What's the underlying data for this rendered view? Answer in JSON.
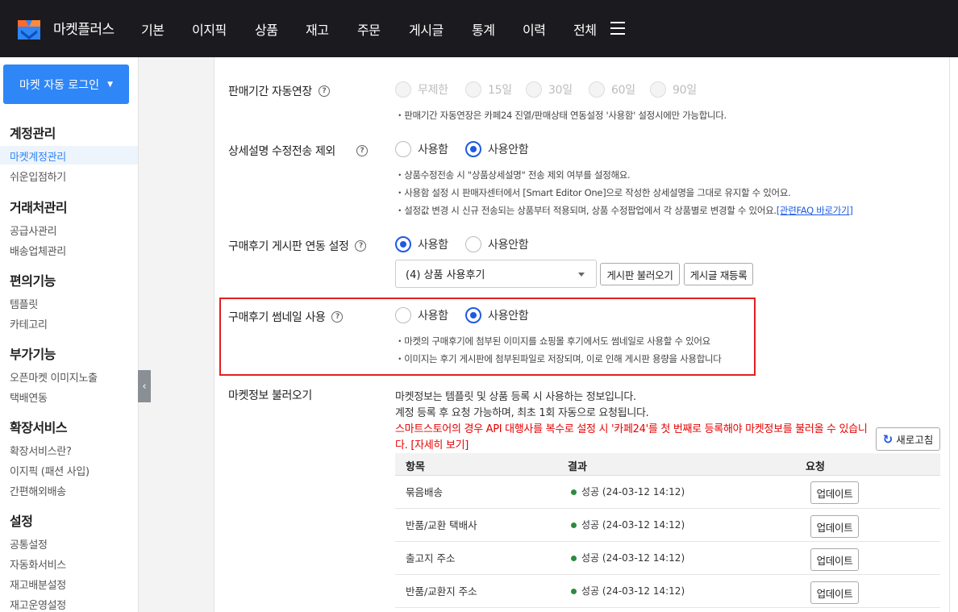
{
  "brand": "마켓플러스",
  "nav": [
    "기본",
    "이지픽",
    "상품",
    "재고",
    "주문",
    "게시글",
    "통계",
    "이력",
    "전체"
  ],
  "sidebar": {
    "login_button": "마켓 자동 로그인",
    "groups": [
      {
        "title": "계정관리",
        "items": [
          "마켓계정관리",
          "쉬운입점하기"
        ]
      },
      {
        "title": "거래처관리",
        "items": [
          "공급사관리",
          "배송업체관리"
        ]
      },
      {
        "title": "편의기능",
        "items": [
          "템플릿",
          "카테고리"
        ]
      },
      {
        "title": "부가기능",
        "items": [
          "오픈마켓 이미지노출",
          "택배연동"
        ]
      },
      {
        "title": "확장서비스",
        "items": [
          "확장서비스란?",
          "이지픽 (패션 사입)",
          "간편해외배송"
        ]
      },
      {
        "title": "설정",
        "items": [
          "공통설정",
          "자동화서비스",
          "재고배분설정",
          "재고운영설정"
        ]
      }
    ]
  },
  "settings": {
    "extend": {
      "label": "판매기간 자동연장",
      "options": [
        "무제한",
        "15일",
        "30일",
        "60일",
        "90일"
      ],
      "note": "・판매기간 자동연장은 카페24 진열/판매상태 연동설정 '사용함' 설정시에만 가능합니다."
    },
    "detail": {
      "label": "상세설명 수정전송 제외",
      "options": [
        "사용함",
        "사용안함"
      ],
      "selected": "사용안함",
      "notes": [
        "・상품수정전송 시 \"상품상세설명\" 전송 제외 여부를 설정해요.",
        "・사용함 설정 시 판매자센터에서 [Smart Editor One]으로 작성한 상세설명을 그대로 유지할 수 있어요.",
        "・설정값 변경 시 신규 전송되는 상품부터 적용되며, 상품 수정팝업에서 각 상품별로 변경할 수 있어요."
      ],
      "faq_link": "[관련FAQ 바로가기]"
    },
    "review_board": {
      "label": "구매후기 게시판 연동 설정",
      "options": [
        "사용함",
        "사용안함"
      ],
      "selected": "사용함",
      "select_value": "(4) 상품 사용후기",
      "btn_load": "게시판 불러오기",
      "btn_reregister": "게시글 재등록"
    },
    "thumbnail": {
      "label": "구매후기 썸네일 사용",
      "options": [
        "사용함",
        "사용안함"
      ],
      "selected": "사용안함",
      "notes": [
        "・마켓의 구매후기에 첨부된 이미지를 쇼핑몰 후기에서도 썸네일로 사용할 수 있어요",
        "・이미지는 후기 게시판에 첨부된파일로 저장되며, 이로 인해 게시판 용량을 사용합니다"
      ]
    },
    "market_info": {
      "label": "마켓정보 불러오기",
      "info1": "마켓정보는 템플릿 및 상품 등록 시 사용하는 정보입니다.",
      "info2": "계정 등록 후 요청 가능하며, 최초 1회 자동으로 요청됩니다.",
      "warn1": "스마트스토어의 경우 API 대행사를 복수로 설정 시 '카페24'를 첫 번째로 등록해야 마켓정보를 불러올 수 있습니",
      "warn2": "다.  [자세히 보기]",
      "refresh": "새로고침",
      "columns": [
        "항목",
        "결과",
        "요청"
      ],
      "rows": [
        {
          "item": "묶음배송",
          "result": "성공 (24-03-12 14:12)",
          "action": "업데이트"
        },
        {
          "item": "반품/교환 택배사",
          "result": "성공 (24-03-12 14:12)",
          "action": "업데이트"
        },
        {
          "item": "출고지 주소",
          "result": "성공 (24-03-12 14:12)",
          "action": "업데이트"
        },
        {
          "item": "반품/교환지 주소",
          "result": "성공 (24-03-12 14:12)",
          "action": "업데이트"
        }
      ]
    }
  },
  "colors": {
    "accent": "#1e5be0",
    "login": "#2f86f6",
    "topbar": "#1b1b1f",
    "highlight": "#e02020",
    "success": "#2e8b3e"
  }
}
